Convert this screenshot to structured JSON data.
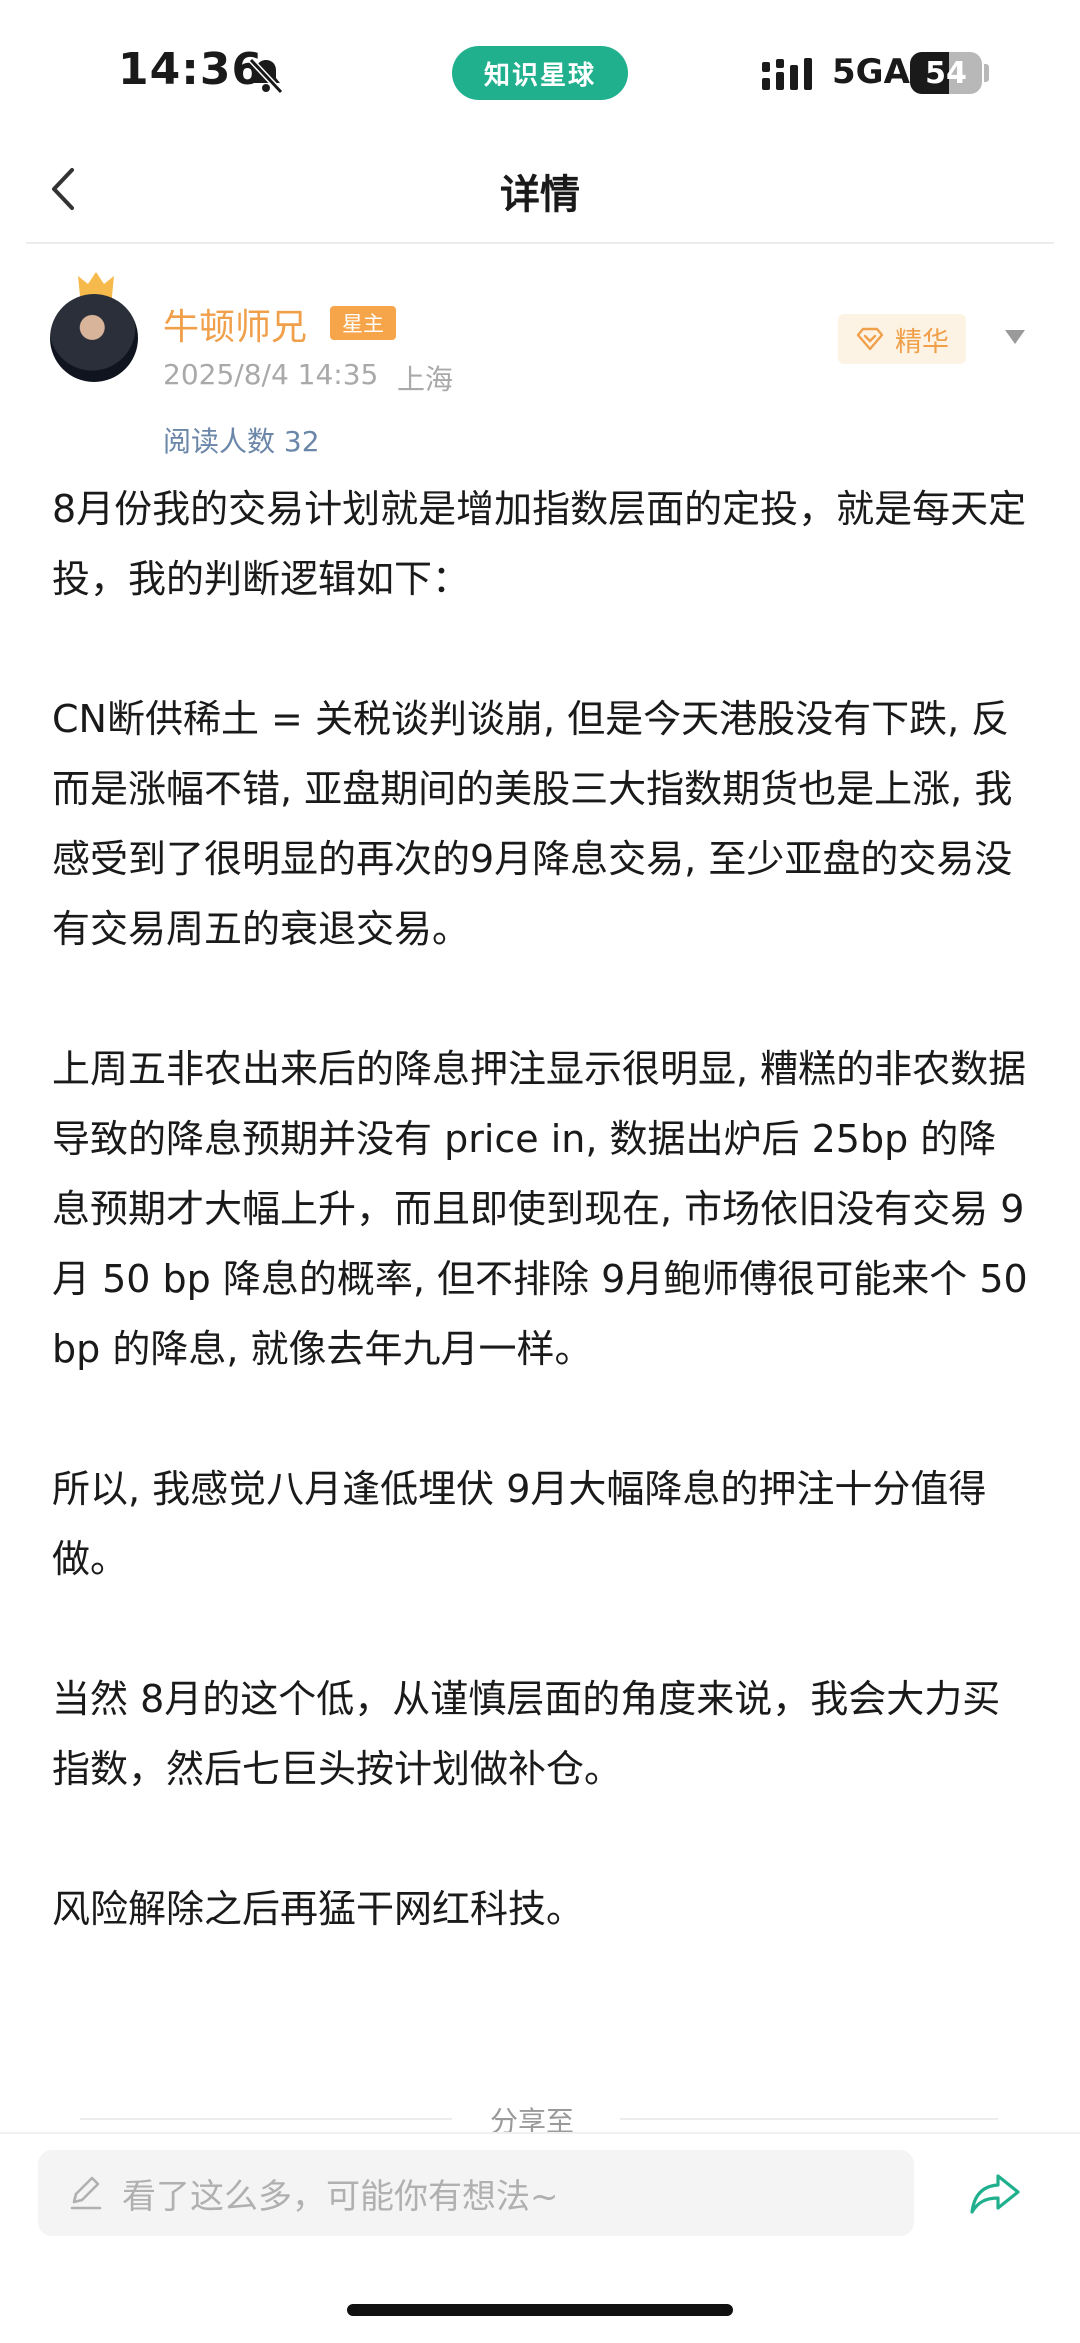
{
  "status_bar": {
    "time": "14:36",
    "app_pill": "知识星球",
    "network": "5GA",
    "battery_percent": 54,
    "battery_text": "54"
  },
  "nav": {
    "title": "详情",
    "back_icon": "chevron-left-icon"
  },
  "post": {
    "author_name": "牛顿师兄",
    "owner_badge": "星主",
    "date": "2025/8/4 14:35",
    "location": "上海",
    "digest_badge": "精华",
    "read_count": "阅读人数 32",
    "paragraphs": [
      "8月份我的交易计划就是增加指数层面的定投，就是每天定投，我的判断逻辑如下：",
      "CN断供稀土 = 关税谈判谈崩, 但是今天港股没有下跌, 反而是涨幅不错, 亚盘期间的美股三大指数期货也是上涨, 我感受到了很明显的再次的9月降息交易, 至少亚盘的交易没有交易周五的衰退交易。",
      "上周五非农出来后的降息押注显示很明显, 糟糕的非农数据导致的降息预期并没有 price in, 数据出炉后 25bp 的降息预期才大幅上升，而且即使到现在, 市场依旧没有交易 9月 50 bp 降息的概率, 但不排除 9月鲍师傅很可能来个 50 bp 的降息, 就像去年九月一样。",
      "所以, 我感觉八月逢低埋伏 9月大幅降息的押注十分值得做。",
      "当然 8月的这个低，从谨慎层面的角度来说，我会大力买指数，然后七巨头按计划做补仓。",
      "风险解除之后再猛干网红科技。"
    ]
  },
  "share": {
    "label": "分享至"
  },
  "comment": {
    "placeholder": "看了这么多，可能你有想法~"
  },
  "colors": {
    "brand_green": "#21b08e",
    "author_orange": "#f0a04b",
    "read_count_blue": "#6a86a8"
  }
}
